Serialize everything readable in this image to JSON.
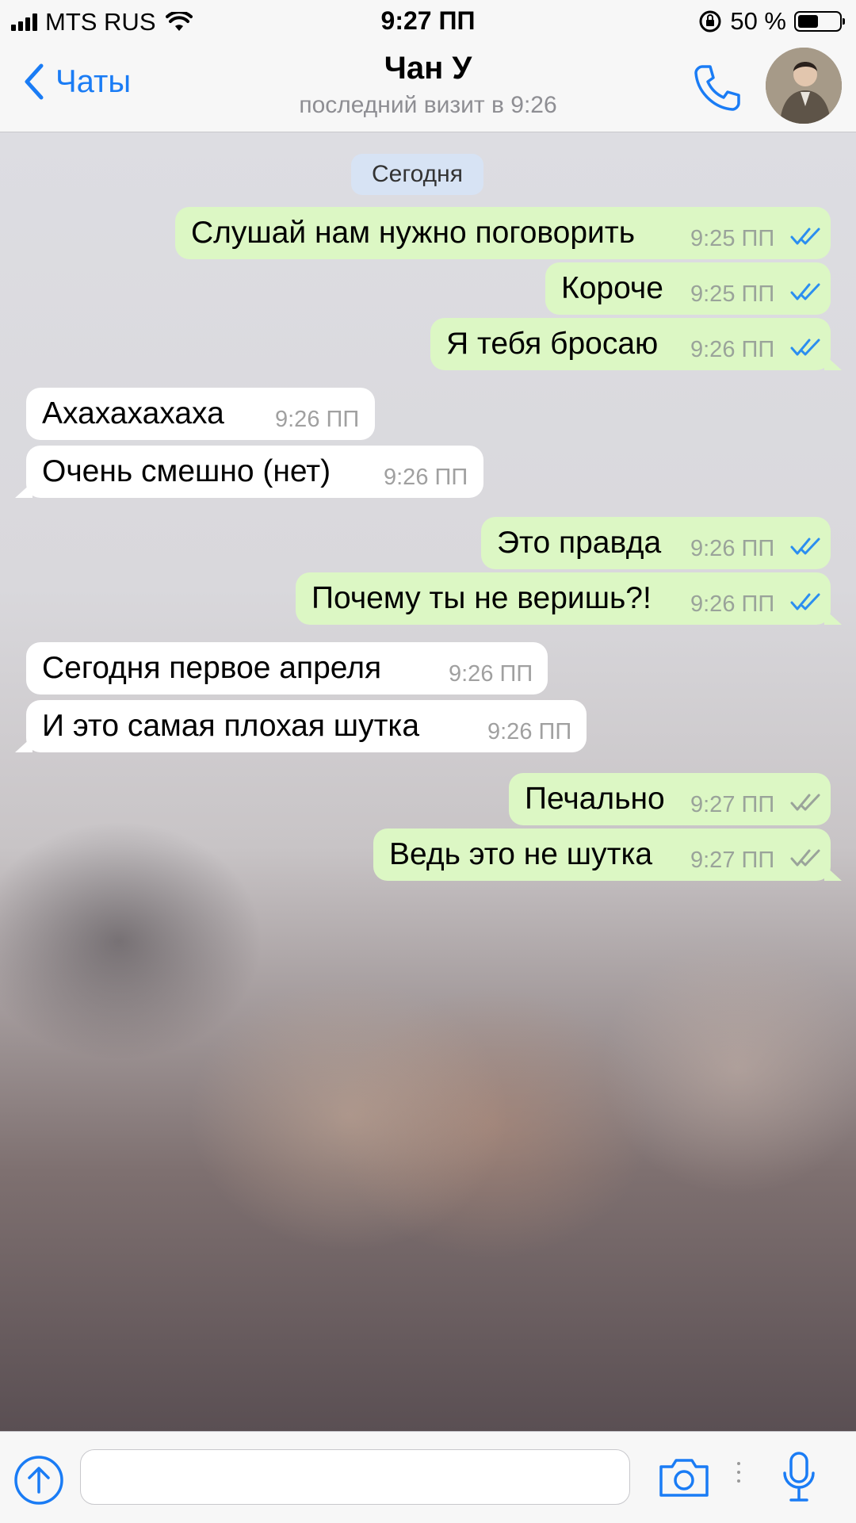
{
  "status_bar": {
    "carrier": "MTS RUS",
    "time": "9:27 ПП",
    "battery": "50 %",
    "battery_level": 0.5
  },
  "header": {
    "back_label": "Чаты",
    "contact_name": "Чан У",
    "last_seen": "последний визит в 9:26"
  },
  "date_separator": "Сегодня",
  "messages": [
    {
      "dir": "out",
      "text": "Слушай нам нужно поговорить",
      "time": "9:25 ПП",
      "status": "read"
    },
    {
      "dir": "out",
      "text": "Короче",
      "time": "9:25 ПП",
      "status": "read"
    },
    {
      "dir": "out",
      "text": "Я тебя бросаю",
      "time": "9:26 ПП",
      "status": "read"
    },
    {
      "dir": "in",
      "text": "Ахахахахаха",
      "time": "9:26 ПП"
    },
    {
      "dir": "in",
      "text": "Очень смешно (нет)",
      "time": "9:26 ПП"
    },
    {
      "dir": "out",
      "text": "Это правда",
      "time": "9:26 ПП",
      "status": "read"
    },
    {
      "dir": "out",
      "text": "Почему ты не веришь?!",
      "time": "9:26 ПП",
      "status": "read"
    },
    {
      "dir": "in",
      "text": "Сегодня первое апреля",
      "time": "9:26 ПП"
    },
    {
      "dir": "in",
      "text": "И это самая плохая шутка",
      "time": "9:26 ПП"
    },
    {
      "dir": "out",
      "text": "Печально",
      "time": "9:27 ПП",
      "status": "delivered"
    },
    {
      "dir": "out",
      "text": "Ведь это не шутка",
      "time": "9:27 ПП",
      "status": "delivered"
    }
  ],
  "input": {
    "placeholder": ""
  },
  "colors": {
    "accent": "#1a7cf5",
    "outgoing_bubble": "#dcf7c4",
    "incoming_bubble": "#ffffff",
    "date_pill": "#d7e3f4"
  },
  "icons": {
    "back": "chevron-left-icon",
    "call": "phone-icon",
    "attach": "upload-arrow-icon",
    "camera": "camera-icon",
    "mic": "microphone-icon"
  }
}
